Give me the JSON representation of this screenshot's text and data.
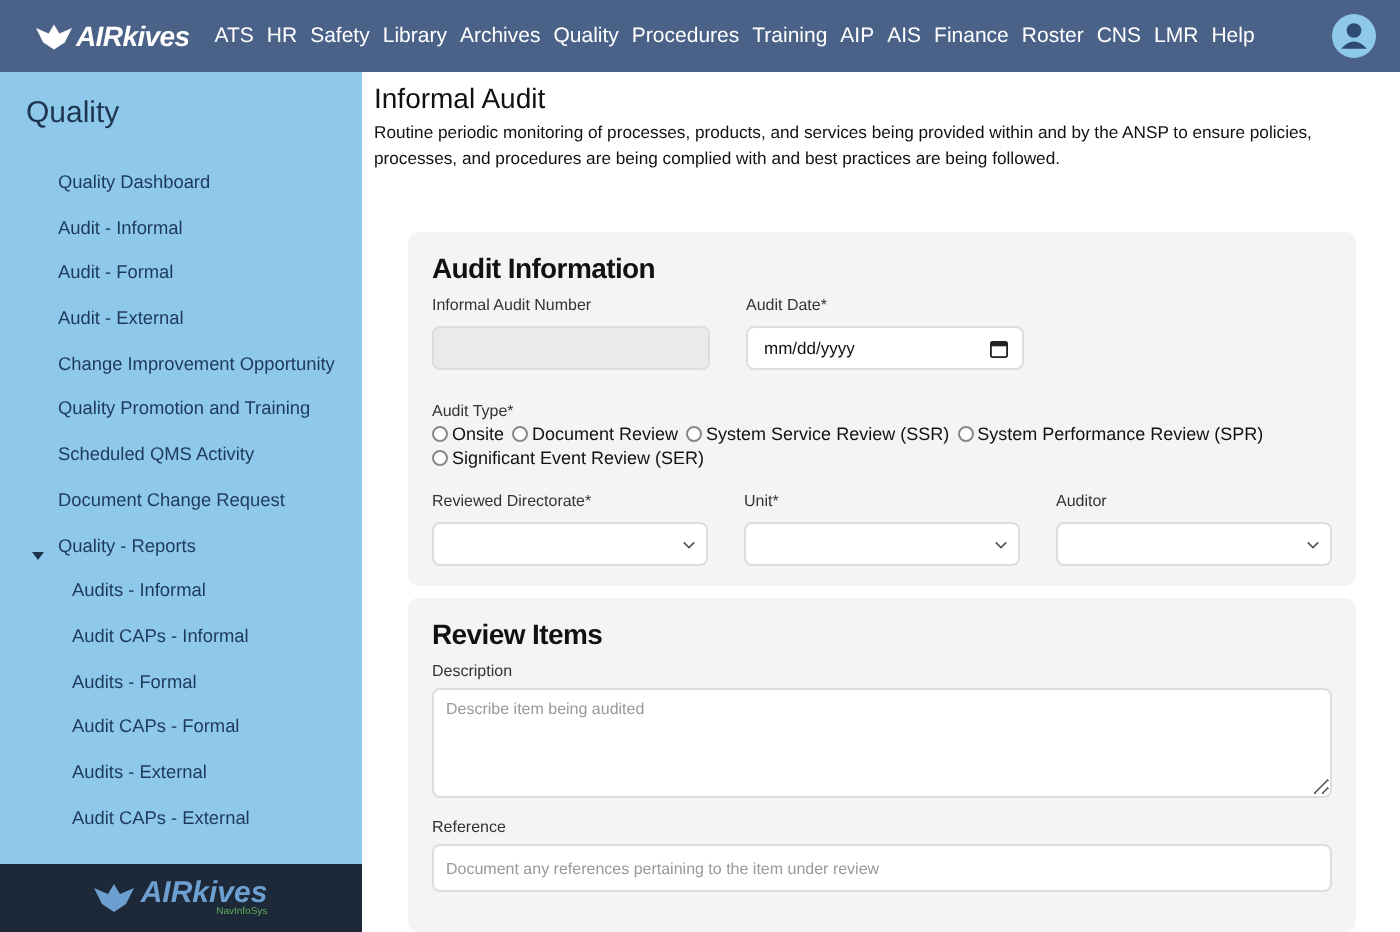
{
  "navbar": {
    "logo": "AIRkives",
    "items": [
      "ATS",
      "HR",
      "Safety",
      "Library",
      "Archives",
      "Quality",
      "Procedures",
      "Training",
      "AIP",
      "AIS",
      "Finance",
      "Roster",
      "CNS",
      "LMR",
      "Help"
    ]
  },
  "sidebar": {
    "title": "Quality",
    "items": [
      {
        "label": "Quality Dashboard"
      },
      {
        "label": "Audit - Informal"
      },
      {
        "label": "Audit - Formal"
      },
      {
        "label": "Audit - External"
      },
      {
        "label": "Change Improvement Opportunity"
      },
      {
        "label": "Quality Promotion and Training"
      },
      {
        "label": "Scheduled QMS Activity"
      },
      {
        "label": "Document Change Request"
      },
      {
        "label": "Quality - Reports",
        "expanded": true,
        "children": [
          {
            "label": "Audits - Informal"
          },
          {
            "label": "Audit CAPs - Informal"
          },
          {
            "label": "Audits - Formal"
          },
          {
            "label": "Audit CAPs - Formal"
          },
          {
            "label": "Audits - External"
          },
          {
            "label": "Audit CAPs - External"
          }
        ]
      }
    ],
    "footer": {
      "logo": "AIRkives",
      "tagline": "NavInfoSys"
    }
  },
  "page": {
    "title": "Informal Audit",
    "description": "Routine periodic monitoring of processes, products, and services being provided within and by the ANSP to ensure policies, processes, and procedures are being complied with and best practices are being followed."
  },
  "audit_information": {
    "title": "Audit Information",
    "audit_number": {
      "label": "Informal Audit Number",
      "disabled": true
    },
    "audit_date": {
      "label": "Audit Date*",
      "placeholder": "mm/dd/yyyy"
    },
    "audit_type": {
      "label": "Audit Type*",
      "options": [
        {
          "label": "Onsite",
          "selected": false
        },
        {
          "label": "Document Review",
          "selected": false
        },
        {
          "label": "System Service Review (SSR)",
          "selected": false
        },
        {
          "label": "System Performance Review (SPR)",
          "selected": false
        },
        {
          "label": "Significant Event Review (SER)",
          "selected": false
        }
      ]
    },
    "selects": [
      {
        "label": "Reviewed Directorate*"
      },
      {
        "label": "Unit*"
      },
      {
        "label": "Auditor"
      }
    ]
  },
  "review_items": {
    "title": "Review Items",
    "fields": [
      {
        "label": "Description",
        "placeholder": "Describe item being audited",
        "kind": "textarea"
      },
      {
        "label": "Reference",
        "placeholder": "Document any references pertaining to the item under review",
        "kind": "text"
      }
    ]
  }
}
